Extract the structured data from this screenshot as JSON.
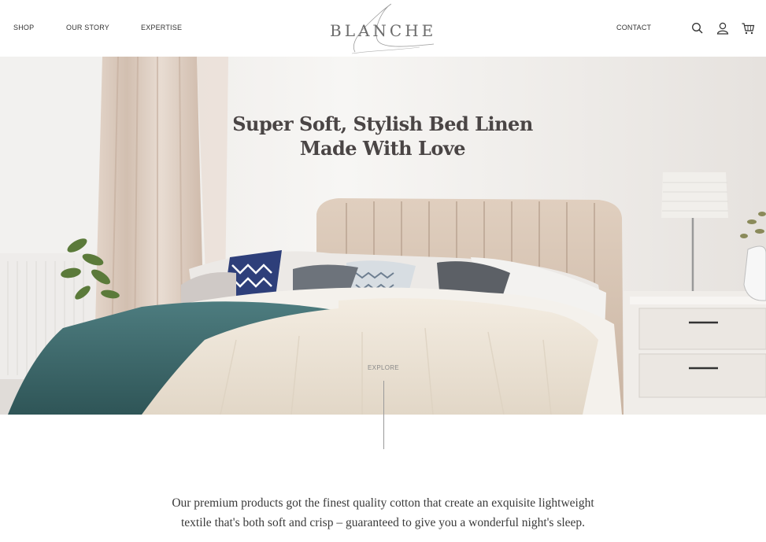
{
  "nav": {
    "shop": "SHOP",
    "our_story": "OUR STORY",
    "expertise": "EXPERTISE",
    "contact": "CONTACT"
  },
  "brand": {
    "logo": "BLANCHE"
  },
  "icons": [
    "search-icon",
    "user-icon",
    "cart-icon"
  ],
  "hero": {
    "title_line1": "Super Soft, Stylish Bed Linen",
    "title_line2": "Made With Love",
    "explore": "EXPLORE"
  },
  "intro": {
    "line1": "Our premium products got the finest quality cotton that create an exquisite lightweight",
    "line2": "textile that's both soft and crisp – guaranteed to give you a wonderful night's sleep."
  },
  "colors": {
    "text": "#333333",
    "headline": "#4a4545",
    "logo": "#6b6b6b",
    "teal_throw": "#3f6d70",
    "headboard": "#d8c7b6"
  }
}
